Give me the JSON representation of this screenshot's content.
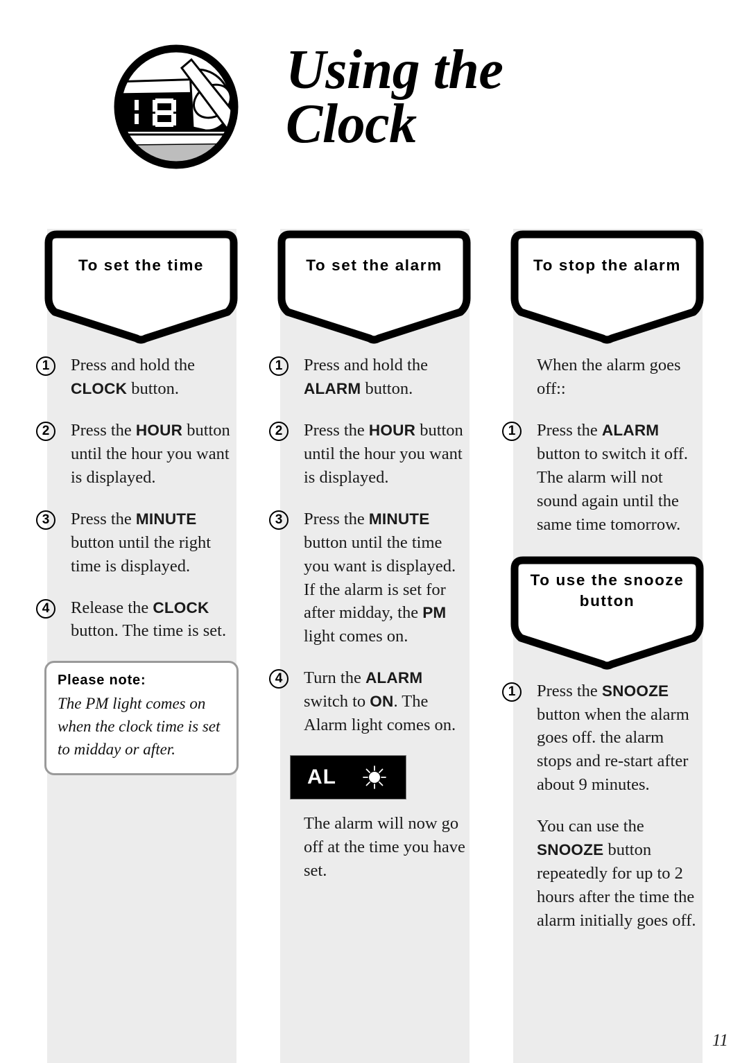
{
  "page": {
    "title_lines": [
      "Using the",
      "Clock"
    ],
    "page_number": "11",
    "icon_name": "clock-display-hand-icon",
    "colors": {
      "column_background": "#ececec",
      "banner_border": "#000000",
      "note_border": "#9a9a9a",
      "display_background": "#000000"
    }
  },
  "columns": [
    {
      "banner": {
        "label": "To set the time",
        "lines": [
          "To set the time"
        ]
      },
      "steps": [
        {
          "num": "1",
          "parts": [
            {
              "t": "Press and hold the ",
              "b": false
            },
            {
              "t": "CLOCK",
              "b": true
            },
            {
              "t": " button.",
              "b": false
            }
          ]
        },
        {
          "num": "2",
          "parts": [
            {
              "t": "Press the ",
              "b": false
            },
            {
              "t": "HOUR",
              "b": true
            },
            {
              "t": " button until the hour you want is displayed.",
              "b": false
            }
          ]
        },
        {
          "num": "3",
          "parts": [
            {
              "t": "Press the ",
              "b": false
            },
            {
              "t": "MINUTE",
              "b": true
            },
            {
              "t": " button until the right time is displayed.",
              "b": false
            }
          ]
        },
        {
          "num": "4",
          "parts": [
            {
              "t": "Release the ",
              "b": false
            },
            {
              "t": "CLOCK",
              "b": true
            },
            {
              "t": " button. The time is set.",
              "b": false
            }
          ]
        }
      ],
      "note": {
        "title": "Please note:",
        "body": "The PM light comes on when the clock time is set to midday or after."
      }
    },
    {
      "banner": {
        "label": "To set the alarm",
        "lines": [
          "To set the alarm"
        ]
      },
      "steps": [
        {
          "num": "1",
          "parts": [
            {
              "t": "Press and hold the ",
              "b": false
            },
            {
              "t": "ALARM",
              "b": true
            },
            {
              "t": " button.",
              "b": false
            }
          ]
        },
        {
          "num": "2",
          "parts": [
            {
              "t": "Press the ",
              "b": false
            },
            {
              "t": "HOUR",
              "b": true
            },
            {
              "t": " button until the hour you want is displayed.",
              "b": false
            }
          ]
        },
        {
          "num": "3",
          "parts": [
            {
              "t": "Press the ",
              "b": false
            },
            {
              "t": "MINUTE",
              "b": true
            },
            {
              "t": " button until the time you want is displayed. If the alarm is set for after midday, the ",
              "b": false
            },
            {
              "t": "PM",
              "b": true
            },
            {
              "t": " light comes on.",
              "b": false
            }
          ]
        },
        {
          "num": "4",
          "parts": [
            {
              "t": "Turn the ",
              "b": false
            },
            {
              "t": "ALARM",
              "b": true
            },
            {
              "t": " switch to ",
              "b": false
            },
            {
              "t": "ON",
              "b": true
            },
            {
              "t": ". The Alarm light comes on.",
              "b": false
            }
          ]
        }
      ],
      "display": {
        "label": "AL",
        "lamp_name": "alarm-lamp-icon"
      },
      "closing": "The alarm will now go off at the time you have set."
    },
    {
      "banner": {
        "label": "To stop the alarm",
        "lines": [
          "To stop the alarm"
        ]
      },
      "intro": "When the alarm goes off::",
      "steps": [
        {
          "num": "1",
          "parts": [
            {
              "t": "Press the ",
              "b": false
            },
            {
              "t": "ALARM",
              "b": true
            },
            {
              "t": " button to switch it off. The alarm will not sound again until the same time tomorrow.",
              "b": false
            }
          ]
        }
      ],
      "banner2": {
        "label": "To use the snooze button",
        "lines": [
          "To use the snooze",
          "button"
        ]
      },
      "steps2": [
        {
          "num": "1",
          "parts": [
            {
              "t": "Press the ",
              "b": false
            },
            {
              "t": "SNOOZE",
              "b": true
            },
            {
              "t": " button when the alarm goes off. the alarm stops and re-start after about 9 minutes.",
              "b": false
            }
          ]
        }
      ],
      "closing_parts": [
        {
          "t": "You can use the ",
          "b": false
        },
        {
          "t": "SNOOZE",
          "b": true
        },
        {
          "t": " button repeatedly for up to 2 hours after the time the alarm initially goes off.",
          "b": false
        }
      ]
    }
  ]
}
